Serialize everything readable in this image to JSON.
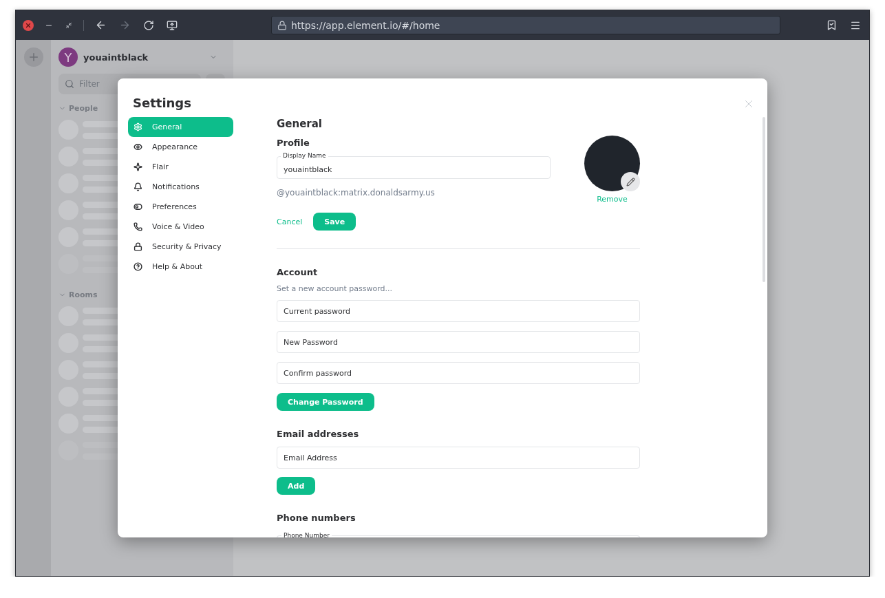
{
  "browser": {
    "url": "https://app.element.io/#/home"
  },
  "sidebar": {
    "avatar_letter": "Y",
    "user_name": "youaintblack",
    "filter": {
      "placeholder": "Filter"
    },
    "sections": [
      {
        "label": "People",
        "expanded": true
      },
      {
        "label": "Rooms",
        "expanded": true
      }
    ]
  },
  "settings": {
    "title": "Settings",
    "nav": [
      {
        "label": "General",
        "selected": true
      },
      {
        "label": "Appearance",
        "selected": false
      },
      {
        "label": "Flair",
        "selected": false
      },
      {
        "label": "Notifications",
        "selected": false
      },
      {
        "label": "Preferences",
        "selected": false
      },
      {
        "label": "Voice & Video",
        "selected": false
      },
      {
        "label": "Security & Privacy",
        "selected": false
      },
      {
        "label": "Help & About",
        "selected": false
      }
    ],
    "heading": "General",
    "profile": {
      "heading": "Profile",
      "display_name": {
        "label": "Display Name",
        "value": "youaintblack"
      },
      "user_id": "@youaintblack:matrix.donaldsarmy.us",
      "cancel": "Cancel",
      "save": "Save",
      "remove": "Remove"
    },
    "account": {
      "heading": "Account",
      "password_link": "Set a new account password...",
      "fields": [
        {
          "placeholder": "Current password"
        },
        {
          "placeholder": "New Password"
        },
        {
          "placeholder": "Confirm password"
        }
      ],
      "button": "Change Password"
    },
    "email": {
      "heading": "Email addresses",
      "field": {
        "placeholder": "Email Address"
      },
      "button": "Add"
    },
    "phone": {
      "heading": "Phone numbers",
      "field": {
        "label": "Phone Number"
      }
    }
  }
}
